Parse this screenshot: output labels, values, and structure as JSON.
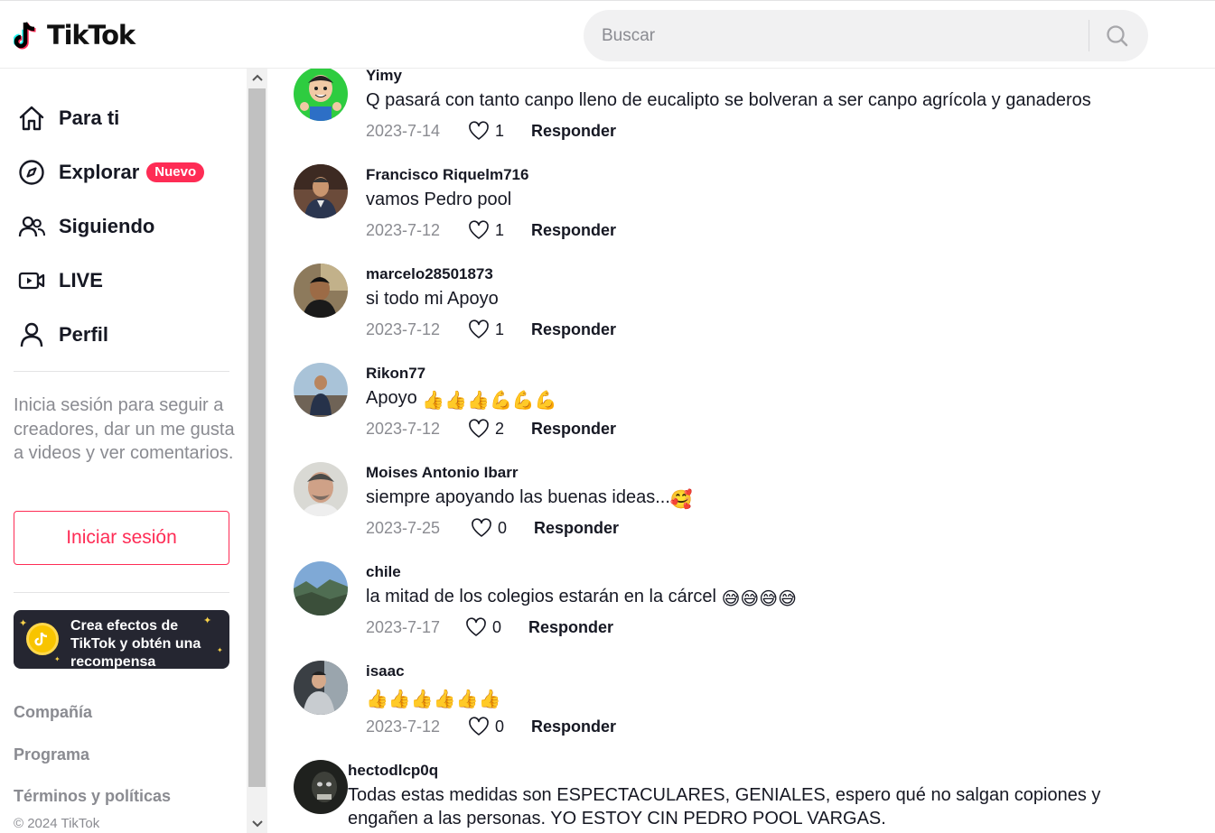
{
  "header": {
    "logo_text": "TikTok",
    "search_placeholder": "Buscar"
  },
  "sidebar": {
    "nav": [
      {
        "label": "Para ti",
        "icon": "home-icon"
      },
      {
        "label": "Explorar",
        "icon": "compass-icon",
        "badge": "Nuevo"
      },
      {
        "label": "Siguiendo",
        "icon": "users-icon"
      },
      {
        "label": "LIVE",
        "icon": "live-icon"
      },
      {
        "label": "Perfil",
        "icon": "person-icon"
      }
    ],
    "login_hint": "Inicia sesión para seguir a creadores, dar un me gusta a videos y ver comentarios.",
    "login_button": "Iniciar sesión",
    "promo_text": "Crea efectos de TikTok y obtén una recompensa",
    "footer_links": [
      "Compañía",
      "Programa",
      "Términos y políticas"
    ],
    "copyright": "© 2024 TikTok"
  },
  "colors": {
    "accent": "#fe2c55",
    "muted": "#8a8b91",
    "text": "#161823"
  },
  "reply_label": "Responder",
  "comments": [
    {
      "user": "Yimy",
      "text": "Q pasará con tanto canpo lleno de eucalipto se bolveran a ser canpo agrícola y ganaderos",
      "emojis": "",
      "date": "2023-7-14",
      "likes": "1"
    },
    {
      "user": "Francisco Riquelm716",
      "text": "vamos Pedro pool",
      "emojis": "",
      "date": "2023-7-12",
      "likes": "1"
    },
    {
      "user": "marcelo28501873",
      "text": "si todo mi Apoyo",
      "emojis": "",
      "date": "2023-7-12",
      "likes": "1"
    },
    {
      "user": "Rikon77",
      "text": "Apoyo",
      "emojis": "👍👍👍💪💪💪",
      "date": "2023-7-12",
      "likes": "2"
    },
    {
      "user": "Moises Antonio Ibarr",
      "text": "siempre apoyando las buenas ideas...",
      "emojis": "🥰",
      "date": "2023-7-25",
      "likes": "0"
    },
    {
      "user": "chile",
      "text": "la mitad de los colegios estarán en la cárcel",
      "emojis": "😅😅😅😅",
      "date": "2023-7-17",
      "likes": "0"
    },
    {
      "user": "isaac",
      "text": "",
      "emojis": "👍👍👍👍👍👍",
      "date": "2023-7-12",
      "likes": "0"
    },
    {
      "user": "hectodlcp0q",
      "text": "Todas estas medidas son ESPECTACULARES, GENIALES, espero qué no salgan copiones y engañen a las personas. YO ESTOY CIN PEDRO POOL VARGAS.",
      "emojis": "",
      "date": "",
      "likes": ""
    }
  ]
}
